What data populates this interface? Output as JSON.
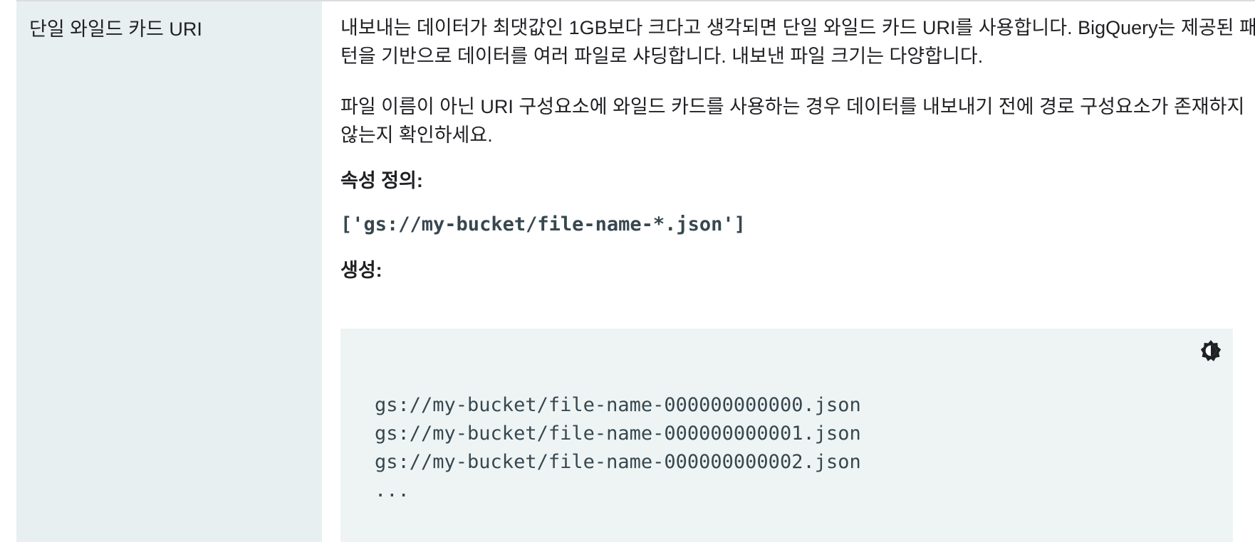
{
  "row": {
    "name": "단일 와일드 카드 URI",
    "paragraphs": [
      "내보내는 데이터가 최댓값인 1GB보다 크다고 생각되면 단일 와일드 카드 URI를 사용합니다. BigQuery는 제공된 패턴을 기반으로 데이터를 여러 파일로 샤딩합니다. 내보낸 파일 크기는 다양합니다.",
      "파일 이름이 아닌 URI 구성요소에 와일드 카드를 사용하는 경우 데이터를 내보내기 전에 경로 구성요소가 존재하지 않는지 확인하세요."
    ],
    "property_label": "속성 정의:",
    "property_value": "['gs://my-bucket/file-name-*.json']",
    "creates_label": "생성:",
    "code_lines": [
      "gs://my-bucket/file-name-000000000000.json",
      "gs://my-bucket/file-name-000000000001.json",
      "gs://my-bucket/file-name-000000000002.json",
      "..."
    ],
    "toggle_icon": "dark-mode-toggle-icon"
  }
}
